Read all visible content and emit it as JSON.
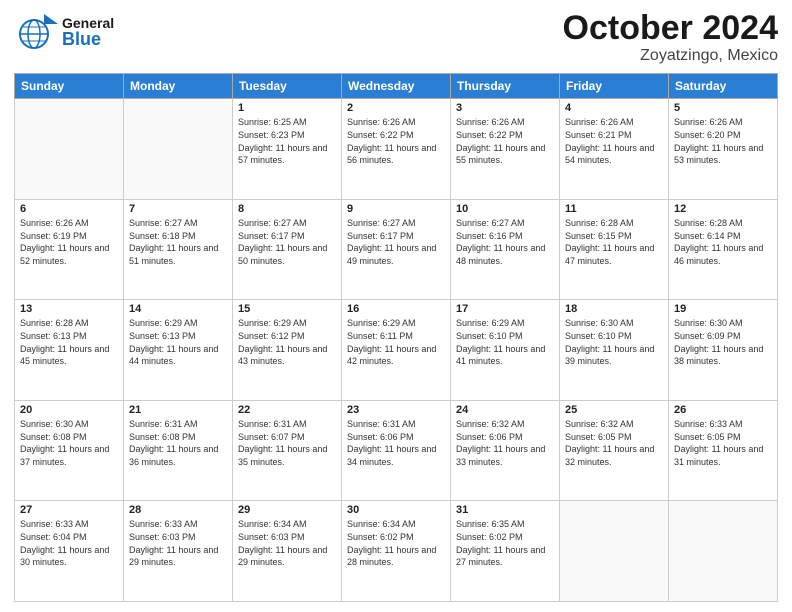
{
  "header": {
    "title": "October 2024",
    "subtitle": "Zoyatzingo, Mexico",
    "logo_general": "General",
    "logo_blue": "Blue"
  },
  "days_of_week": [
    "Sunday",
    "Monday",
    "Tuesday",
    "Wednesday",
    "Thursday",
    "Friday",
    "Saturday"
  ],
  "weeks": [
    [
      {
        "day": "",
        "info": ""
      },
      {
        "day": "",
        "info": ""
      },
      {
        "day": "1",
        "info": "Sunrise: 6:25 AM\nSunset: 6:23 PM\nDaylight: 11 hours and 57 minutes."
      },
      {
        "day": "2",
        "info": "Sunrise: 6:26 AM\nSunset: 6:22 PM\nDaylight: 11 hours and 56 minutes."
      },
      {
        "day": "3",
        "info": "Sunrise: 6:26 AM\nSunset: 6:22 PM\nDaylight: 11 hours and 55 minutes."
      },
      {
        "day": "4",
        "info": "Sunrise: 6:26 AM\nSunset: 6:21 PM\nDaylight: 11 hours and 54 minutes."
      },
      {
        "day": "5",
        "info": "Sunrise: 6:26 AM\nSunset: 6:20 PM\nDaylight: 11 hours and 53 minutes."
      }
    ],
    [
      {
        "day": "6",
        "info": "Sunrise: 6:26 AM\nSunset: 6:19 PM\nDaylight: 11 hours and 52 minutes."
      },
      {
        "day": "7",
        "info": "Sunrise: 6:27 AM\nSunset: 6:18 PM\nDaylight: 11 hours and 51 minutes."
      },
      {
        "day": "8",
        "info": "Sunrise: 6:27 AM\nSunset: 6:17 PM\nDaylight: 11 hours and 50 minutes."
      },
      {
        "day": "9",
        "info": "Sunrise: 6:27 AM\nSunset: 6:17 PM\nDaylight: 11 hours and 49 minutes."
      },
      {
        "day": "10",
        "info": "Sunrise: 6:27 AM\nSunset: 6:16 PM\nDaylight: 11 hours and 48 minutes."
      },
      {
        "day": "11",
        "info": "Sunrise: 6:28 AM\nSunset: 6:15 PM\nDaylight: 11 hours and 47 minutes."
      },
      {
        "day": "12",
        "info": "Sunrise: 6:28 AM\nSunset: 6:14 PM\nDaylight: 11 hours and 46 minutes."
      }
    ],
    [
      {
        "day": "13",
        "info": "Sunrise: 6:28 AM\nSunset: 6:13 PM\nDaylight: 11 hours and 45 minutes."
      },
      {
        "day": "14",
        "info": "Sunrise: 6:29 AM\nSunset: 6:13 PM\nDaylight: 11 hours and 44 minutes."
      },
      {
        "day": "15",
        "info": "Sunrise: 6:29 AM\nSunset: 6:12 PM\nDaylight: 11 hours and 43 minutes."
      },
      {
        "day": "16",
        "info": "Sunrise: 6:29 AM\nSunset: 6:11 PM\nDaylight: 11 hours and 42 minutes."
      },
      {
        "day": "17",
        "info": "Sunrise: 6:29 AM\nSunset: 6:10 PM\nDaylight: 11 hours and 41 minutes."
      },
      {
        "day": "18",
        "info": "Sunrise: 6:30 AM\nSunset: 6:10 PM\nDaylight: 11 hours and 39 minutes."
      },
      {
        "day": "19",
        "info": "Sunrise: 6:30 AM\nSunset: 6:09 PM\nDaylight: 11 hours and 38 minutes."
      }
    ],
    [
      {
        "day": "20",
        "info": "Sunrise: 6:30 AM\nSunset: 6:08 PM\nDaylight: 11 hours and 37 minutes."
      },
      {
        "day": "21",
        "info": "Sunrise: 6:31 AM\nSunset: 6:08 PM\nDaylight: 11 hours and 36 minutes."
      },
      {
        "day": "22",
        "info": "Sunrise: 6:31 AM\nSunset: 6:07 PM\nDaylight: 11 hours and 35 minutes."
      },
      {
        "day": "23",
        "info": "Sunrise: 6:31 AM\nSunset: 6:06 PM\nDaylight: 11 hours and 34 minutes."
      },
      {
        "day": "24",
        "info": "Sunrise: 6:32 AM\nSunset: 6:06 PM\nDaylight: 11 hours and 33 minutes."
      },
      {
        "day": "25",
        "info": "Sunrise: 6:32 AM\nSunset: 6:05 PM\nDaylight: 11 hours and 32 minutes."
      },
      {
        "day": "26",
        "info": "Sunrise: 6:33 AM\nSunset: 6:05 PM\nDaylight: 11 hours and 31 minutes."
      }
    ],
    [
      {
        "day": "27",
        "info": "Sunrise: 6:33 AM\nSunset: 6:04 PM\nDaylight: 11 hours and 30 minutes."
      },
      {
        "day": "28",
        "info": "Sunrise: 6:33 AM\nSunset: 6:03 PM\nDaylight: 11 hours and 29 minutes."
      },
      {
        "day": "29",
        "info": "Sunrise: 6:34 AM\nSunset: 6:03 PM\nDaylight: 11 hours and 29 minutes."
      },
      {
        "day": "30",
        "info": "Sunrise: 6:34 AM\nSunset: 6:02 PM\nDaylight: 11 hours and 28 minutes."
      },
      {
        "day": "31",
        "info": "Sunrise: 6:35 AM\nSunset: 6:02 PM\nDaylight: 11 hours and 27 minutes."
      },
      {
        "day": "",
        "info": ""
      },
      {
        "day": "",
        "info": ""
      }
    ]
  ]
}
